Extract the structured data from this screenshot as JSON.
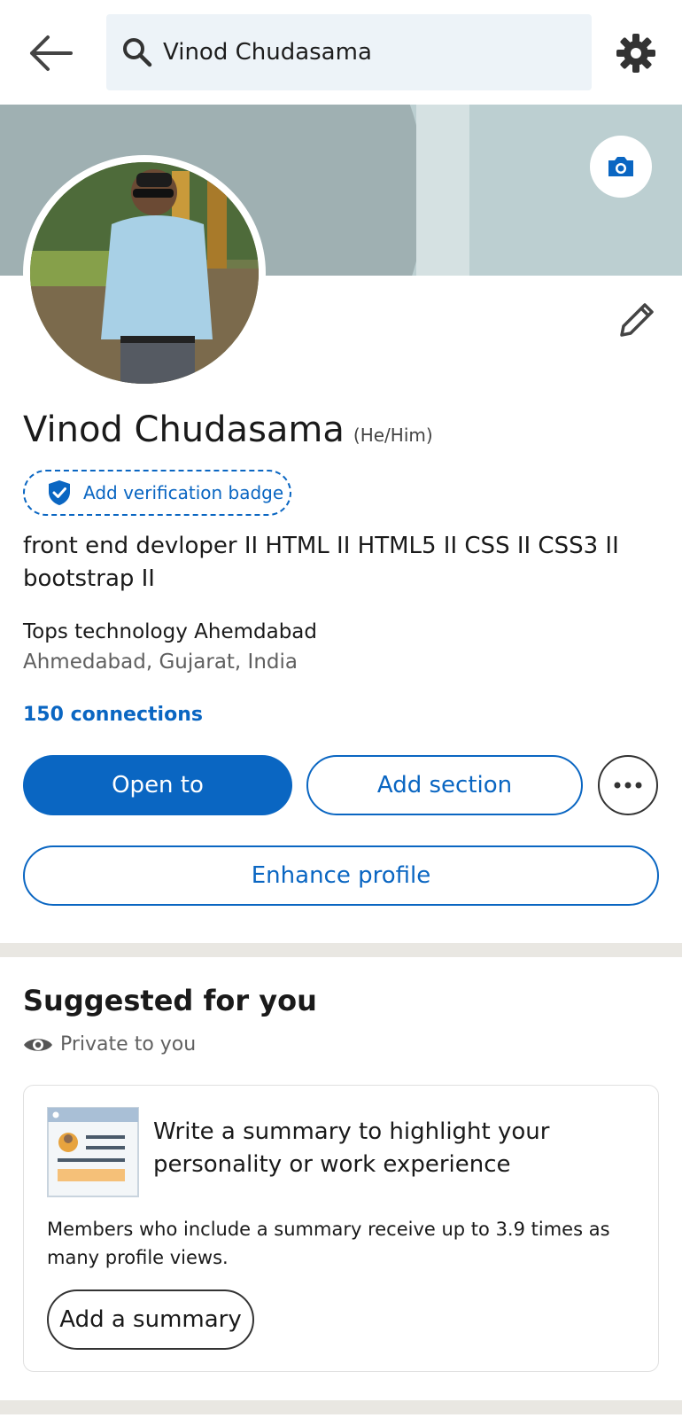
{
  "header": {
    "back_icon": "arrow-left-icon",
    "search_icon": "search-icon",
    "search_value": "Vinod Chudasama",
    "settings_icon": "gear-icon"
  },
  "banner": {
    "camera_icon": "camera-icon"
  },
  "profile": {
    "name": "Vinod Chudasama",
    "pronouns": "(He/Him)",
    "verification_label": "Add verification badge",
    "headline": "front end devloper II HTML II  HTML5 II CSS II CSS3 II bootstrap II",
    "company": "Tops technology Ahemdabad",
    "location": "Ahmedabad, Gujarat, India",
    "connections": "150 connections",
    "edit_icon": "pencil-icon"
  },
  "actions": {
    "open_to": "Open to",
    "add_section": "Add section",
    "more_icon": "ellipsis-icon",
    "enhance_profile": "Enhance profile"
  },
  "suggested": {
    "title": "Suggested for you",
    "private_label": "Private to you",
    "card": {
      "title": "Write a summary to highlight your personality or work experience",
      "body": "Members who include a summary receive up to 3.9 times as many profile views.",
      "button": "Add a summary"
    }
  },
  "colors": {
    "accent": "#0a66c2",
    "banner": "#bccfd1",
    "divider": "#e9e7e2"
  }
}
